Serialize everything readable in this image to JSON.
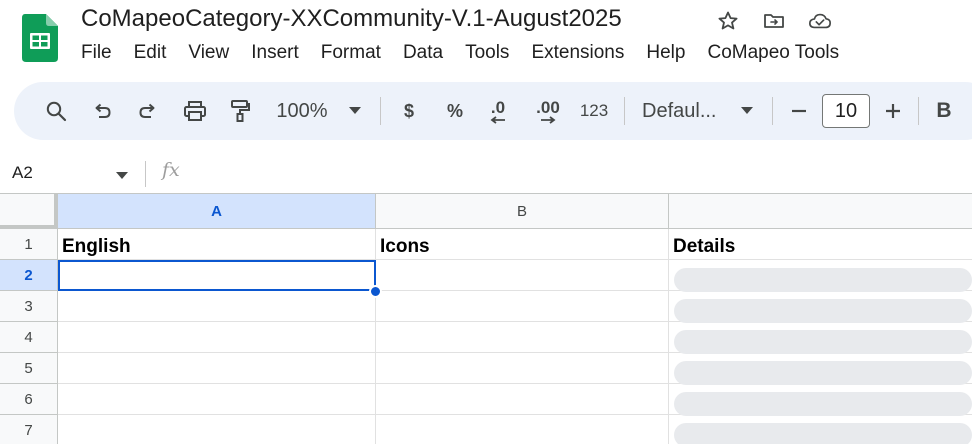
{
  "document": {
    "title": "CoMapeoCategory-XXCommunity-V.1-August2025"
  },
  "menu": [
    "File",
    "Edit",
    "View",
    "Insert",
    "Format",
    "Data",
    "Tools",
    "Extensions",
    "Help",
    "CoMapeo Tools"
  ],
  "toolbar": {
    "zoom": "100%",
    "currency": "$",
    "percent": "%",
    "decrease_decimal": ".0",
    "increase_decimal": ".00",
    "number_format": "123",
    "font": "Defaul...",
    "font_size": "10",
    "bold": "B"
  },
  "formula_bar": {
    "cell_ref": "A2",
    "fx": "fx",
    "value": ""
  },
  "sheet": {
    "columns": [
      "A",
      "B",
      ""
    ],
    "rows": [
      "1",
      "2",
      "3",
      "4",
      "5",
      "6",
      "7"
    ],
    "headers": [
      "English",
      "Icons",
      "Details"
    ],
    "selected_cell": "A2"
  },
  "colors": {
    "accent": "#0b57d0",
    "toolbar_bg": "#edf2fa",
    "selected_header_bg": "#d3e3fd",
    "logo_green": "#0f9d58",
    "placeholder_chip": "#e8eaed"
  },
  "icons": {
    "logo": "google-sheets-logo",
    "star": "star-icon",
    "move": "move-to-folder-icon",
    "cloud": "cloud-saved-icon",
    "search": "search-icon",
    "undo": "undo-icon",
    "redo": "redo-icon",
    "print": "print-icon",
    "paint_format": "paint-format-icon",
    "dropdown": "chevron-down-icon",
    "minus": "minus-icon",
    "plus": "plus-icon"
  }
}
